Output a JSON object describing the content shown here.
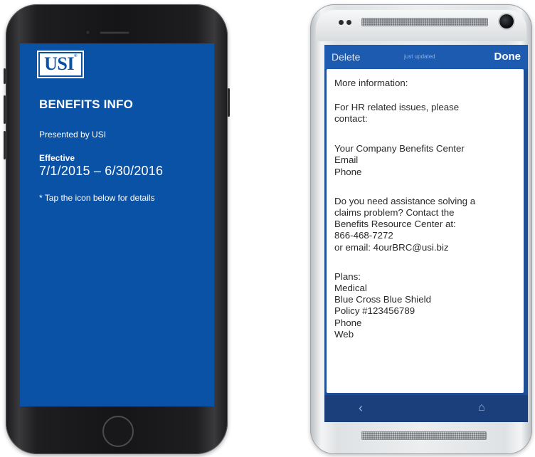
{
  "left_phone": {
    "logo": "USI",
    "title": "BENEFITS INFO",
    "presented_by": "Presented by USI",
    "effective_label": "Effective",
    "effective_range": "7/1/2015 – 6/30/2016",
    "tap_hint": "* Tap the icon below for details",
    "screen_color": "#0a52a6"
  },
  "right_phone": {
    "nav": {
      "delete_label": "Delete",
      "status": "just updated",
      "done_label": "Done"
    },
    "note_lines": [
      "More information:",
      "For HR related issues, please",
      "contact:",
      "Your Company Benefits Center",
      "Email",
      "Phone",
      "Do you need assistance solving a",
      "claims problem? Contact the",
      "Benefits Resource Center at:",
      "866-468-7272",
      "or email: 4ourBRC@usi.biz",
      "Plans:",
      "Medical",
      "Blue Cross Blue Shield",
      "Policy #123456789",
      "Phone",
      "Web"
    ],
    "system_bar": {
      "back_icon": "back-icon",
      "home_icon": "home-icon"
    },
    "accent_color": "#1d5bb0"
  }
}
